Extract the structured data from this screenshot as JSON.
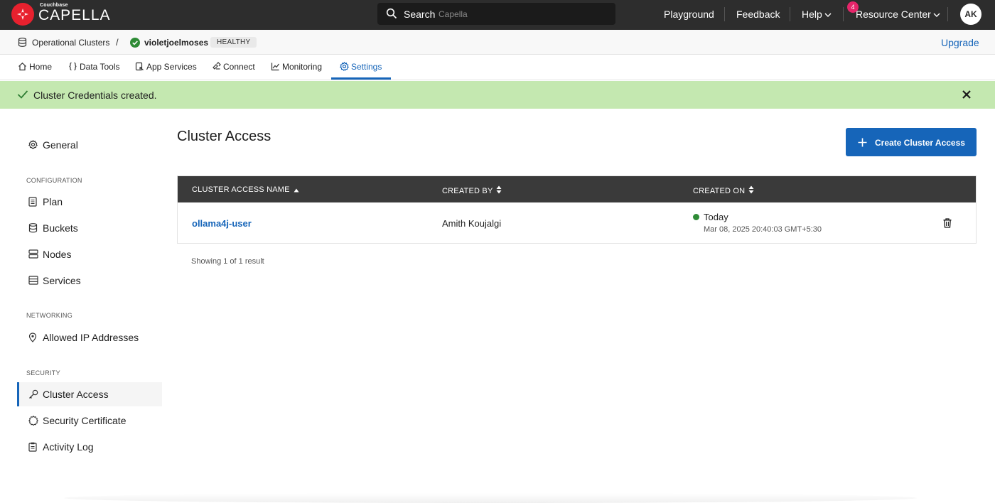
{
  "app": {
    "brand_small": "Couchbase",
    "brand": "CAPELLA"
  },
  "topbar": {
    "search_label": "Search",
    "search_placeholder": "Capella",
    "playground": "Playground",
    "feedback": "Feedback",
    "help": "Help",
    "resource_center": "Resource Center",
    "notification_count": "4",
    "user_initials": "AK"
  },
  "breadcrumb": {
    "clusters": "Operational Clusters",
    "separator": "/",
    "cluster_name": "violetjoelmoses",
    "cluster_status": "HEALTHY",
    "upgrade": "Upgrade"
  },
  "tabs": {
    "home": "Home",
    "data_tools": "Data Tools",
    "app_services": "App Services",
    "connect": "Connect",
    "monitoring": "Monitoring",
    "settings": "Settings",
    "active": "Settings"
  },
  "banner": {
    "message": "Cluster Credentials created."
  },
  "sidebar": {
    "general": "General",
    "configuration_heading": "CONFIGURATION",
    "plan": "Plan",
    "buckets": "Buckets",
    "nodes": "Nodes",
    "services": "Services",
    "networking_heading": "NETWORKING",
    "allowed_ip": "Allowed IP Addresses",
    "security_heading": "SECURITY",
    "cluster_access": "Cluster Access",
    "security_certificate": "Security Certificate",
    "activity_log": "Activity Log",
    "active": "Cluster Access"
  },
  "main": {
    "title": "Cluster Access",
    "create_button": "Create Cluster Access",
    "table": {
      "columns": [
        "CLUSTER ACCESS NAME",
        "CREATED BY",
        "CREATED ON"
      ],
      "rows": [
        {
          "name": "ollama4j-user",
          "created_by": "Amith Koujalgi",
          "created_on_label": "Today",
          "created_on_timestamp": "Mar 08, 2025 20:40:03 GMT+5:30"
        }
      ]
    },
    "result_count": "Showing 1 of 1 result"
  },
  "colors": {
    "topbar": "#2d2d2d",
    "accent": "#1665b9",
    "brand_red": "#e8212e",
    "success_banner": "#c4e8b0",
    "status_green": "#2e8b36",
    "notification_pink": "#e6256a"
  }
}
